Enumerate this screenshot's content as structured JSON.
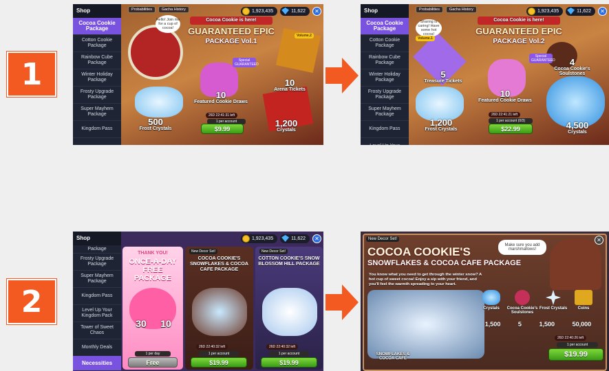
{
  "steps": {
    "one": "1",
    "two": "2"
  },
  "shop": {
    "title": "Shop",
    "coins": "1,923,435",
    "crystals": "11,622",
    "close_icon": "✕",
    "tab_probabilities": "Probabilities",
    "tab_gacha_history": "Gacha History"
  },
  "sidebar_a": [
    "Cocoa Cookie Package",
    "Cotton Cookie Package",
    "Rainbow Cube Package",
    "Winter Holiday Package",
    "Frosty Upgrade Package",
    "Super Mayhem Package",
    "Kingdom Pass"
  ],
  "sidebar_b": [
    "Cocoa Cookie Package",
    "Cotton Cookie Package",
    "Rainbow Cube Package",
    "Winter Holiday Package",
    "Frosty Upgrade Package",
    "Super Mayhem Package",
    "Kingdom Pass",
    "Level Up Your"
  ],
  "sidebar_c": [
    "Package",
    "Frosty Upgrade Package",
    "Super Mayhem Package",
    "Kingdom Pass",
    "Level Up Your Kingdom Pack",
    "Tower of Sweet Chaos",
    "Monthly Deals",
    "Necessities"
  ],
  "panel1": {
    "ribbon": "Cocoa Cookie is here!",
    "title": "GUARANTEED EPIC",
    "subtitle": "PACKAGE Vol.1",
    "bubble": "Hello! Join me for a cup of cocoa!",
    "volume_btn": "Volume.2",
    "special": "Special GUARANTEED",
    "items": [
      {
        "num": "10",
        "text": "Arena Tickets"
      },
      {
        "num": "10",
        "text": "Featured Cookie Draws"
      },
      {
        "num": "500",
        "text": "Frost Crystals"
      },
      {
        "num": "1,200",
        "text": "Crystals"
      }
    ],
    "timer": "26D 22:41:31 left",
    "limit": "1 per account",
    "price": "$9.99"
  },
  "panel2": {
    "ribbon": "Cocoa Cookie is here!",
    "title": "GUARANTEED EPIC",
    "subtitle": "PACKAGE Vol.2",
    "bubble": "Sharing is caring! Have some hot cocoa!",
    "volume_btn": "Volume.1",
    "special": "Special GUARANTEED",
    "items": [
      {
        "num": "5",
        "text": "Treasure Tickets"
      },
      {
        "num": "10",
        "text": "Featured Cookie Draws"
      },
      {
        "num": "4",
        "text": "Cocoa Cookie's Soulstones"
      },
      {
        "num": "1,200",
        "text": "Frost Crystals"
      },
      {
        "num": "4,500",
        "text": "Crystals"
      }
    ],
    "timer": "26D 22:41:21 left",
    "limit": "1 per account (0/3)",
    "price": "$22.99"
  },
  "panel3": {
    "free_card": {
      "thanks": "THANK YOU!",
      "title": "ONCE-A-DAY FREE PACKAGE",
      "gems": "30",
      "clovers": "10",
      "limit": "1 per day",
      "price": "Free"
    },
    "cocoa_card": {
      "badge": "New Decor Set!",
      "title": "COCOA COOKIE'S SNOWFLAKES & COCOA CAFE PACKAGE",
      "timer": "26D 22:40:32 left",
      "limit": "1 per account",
      "price": "$19.99"
    },
    "cotton_card": {
      "badge": "New Decor Set!",
      "title": "COTTON COOKIE'S SNOW BLOSSOM HILL PACKAGE",
      "timer": "26D 22:40:32 left",
      "limit": "1 per account",
      "price": "$19.99"
    }
  },
  "panel4": {
    "badge": "New Decor Set!",
    "title1": "COCOA COOKIE'S",
    "title2": "SNOWFLAKES & COCOA CAFE PACKAGE",
    "bubble": "Make sure you add marshmallows!",
    "desc": "You know what you need to get through the winter snow? A hot cup of sweet cocoa! Enjoy a sip with your friend, and you'll feel the warmth spreading to your heart.",
    "rewards": [
      {
        "label": "Crystals",
        "value": "1,500"
      },
      {
        "label": "Cocoa Cookie's Soulstones",
        "value": "5"
      },
      {
        "label": "Frost Crystals",
        "value": "1,500"
      },
      {
        "label": "Coins",
        "value": "50,000"
      }
    ],
    "set_label": "SNOWFLAKES & COCOA CAFE",
    "timer": "26D 22:40:26 left",
    "limit": "1 per account",
    "price": "$19.99",
    "close_icon": "✕"
  }
}
